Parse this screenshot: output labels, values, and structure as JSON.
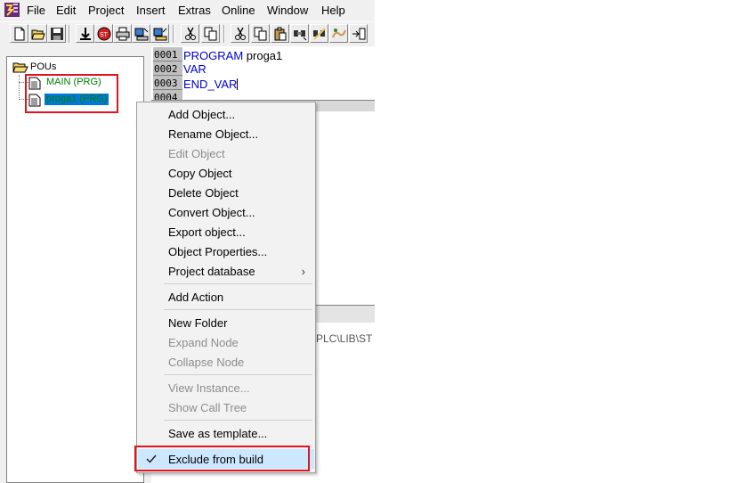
{
  "menubar": {
    "items": [
      "File",
      "Edit",
      "Project",
      "Insert",
      "Extras",
      "Online",
      "Window",
      "Help"
    ]
  },
  "toolbar": {
    "buttons": [
      "new-icon",
      "open-icon",
      "save-icon",
      "build-icon",
      "stop-icon",
      "print-icon",
      "login-icon",
      "logout-icon",
      "cut-icon",
      "copy-icon",
      "cut-2-icon",
      "copy-2-icon",
      "paste-icon",
      "find-icon",
      "find-next-icon",
      "replace-icon",
      "input-assistant-icon"
    ]
  },
  "tree": {
    "root_label": "POUs",
    "items": [
      {
        "label": "MAIN (PRG)",
        "selected": false
      },
      {
        "label": "proga1 (PRG)",
        "selected": true
      }
    ]
  },
  "editor": {
    "line_numbers": [
      "0001",
      "0002",
      "0003",
      "0004"
    ],
    "lines": [
      {
        "keyword": "PROGRAM",
        "rest": " proga1"
      },
      {
        "keyword": "VAR",
        "rest": ""
      },
      {
        "keyword": "END_VAR",
        "rest": ""
      }
    ],
    "message_text": "PLC\\LIB\\ST"
  },
  "context_menu": {
    "items": [
      {
        "label": "Add Object...",
        "disabled": false
      },
      {
        "label": "Rename Object...",
        "disabled": false
      },
      {
        "label": "Edit Object",
        "disabled": true
      },
      {
        "label": "Copy Object",
        "disabled": false
      },
      {
        "label": "Delete Object",
        "disabled": false
      },
      {
        "label": "Convert Object...",
        "disabled": false
      },
      {
        "label": "Export object...",
        "disabled": false
      },
      {
        "label": "Object Properties...",
        "disabled": false
      },
      {
        "label": "Project database",
        "disabled": false,
        "submenu": true
      },
      {
        "label": "Add Action",
        "disabled": false
      },
      {
        "label": "New Folder",
        "disabled": false
      },
      {
        "label": "Expand Node",
        "disabled": true
      },
      {
        "label": "Collapse Node",
        "disabled": true
      },
      {
        "label": "View Instance...",
        "disabled": true
      },
      {
        "label": "Show Call Tree",
        "disabled": true
      },
      {
        "label": "Save as template...",
        "disabled": false
      },
      {
        "label": "Exclude from build",
        "disabled": false,
        "checked": true
      }
    ],
    "submenu_arrow": "›",
    "check_mark": "✓"
  },
  "colors": {
    "keyword": "#0000d0",
    "tree_item": "#008000",
    "selection": "#0078d7",
    "highlight_box": "#e0141e",
    "checked_bg": "#cce8ff"
  }
}
